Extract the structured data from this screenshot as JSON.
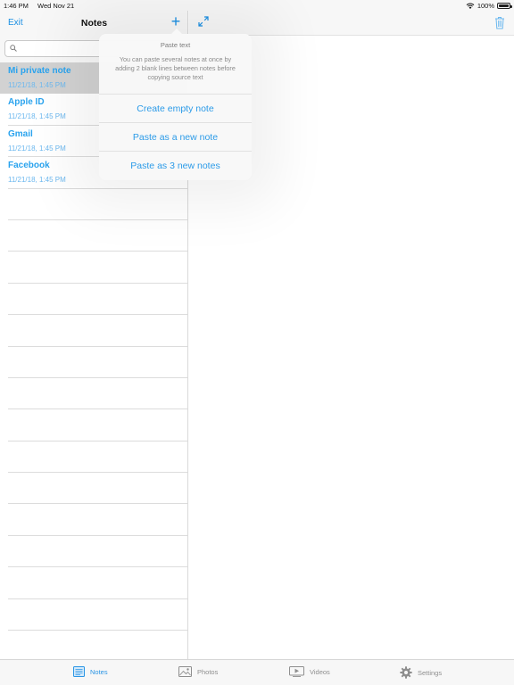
{
  "status": {
    "time": "1:46 PM",
    "date": "Wed Nov 21",
    "battery": "100%"
  },
  "nav": {
    "exit_label": "Exit",
    "title": "Notes",
    "add_label": "+"
  },
  "notes": [
    {
      "title": "Mi private note",
      "date": "11/21/18, 1:45 PM"
    },
    {
      "title": "Apple ID",
      "date": "11/21/18, 1:45 PM"
    },
    {
      "title": "Gmail",
      "date": "11/21/18, 1:45 PM"
    },
    {
      "title": "Facebook",
      "date": "11/21/18, 1:45 PM"
    }
  ],
  "popover": {
    "title": "Paste text",
    "description": "You can paste several notes at once by adding 2 blank lines between notes before copying source text",
    "buttons": [
      "Create empty note",
      "Paste as a new note",
      "Paste as 3 new notes"
    ]
  },
  "tabs": [
    {
      "label": "Notes",
      "icon": "notes-icon"
    },
    {
      "label": "Photos",
      "icon": "photos-icon"
    },
    {
      "label": "Videos",
      "icon": "videos-icon"
    },
    {
      "label": "Settings",
      "icon": "gear-icon"
    }
  ],
  "colors": {
    "accent": "#1a8fe3",
    "selected_row": "#d2d2d2"
  }
}
